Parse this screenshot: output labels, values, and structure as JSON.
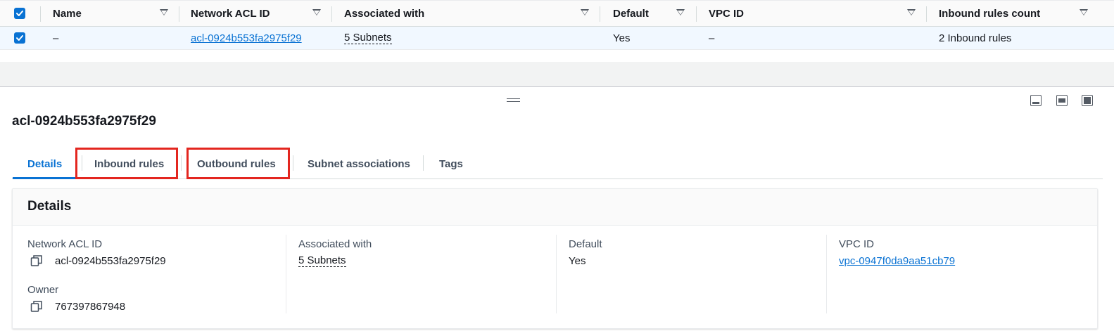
{
  "table": {
    "columns": [
      "Name",
      "Network ACL ID",
      "Associated with",
      "Default",
      "VPC ID",
      "Inbound rules count"
    ],
    "row": {
      "name": "–",
      "network_acl_id": "acl-0924b553fa2975f29",
      "associated_with": "5 Subnets",
      "default": "Yes",
      "vpc_id": "–",
      "inbound_rules_count": "2 Inbound rules",
      "selected": true
    }
  },
  "panel": {
    "title": "acl-0924b553fa2975f29",
    "tabs": [
      "Details",
      "Inbound rules",
      "Outbound rules",
      "Subnet associations",
      "Tags"
    ],
    "active_tab": "Details",
    "highlighted_tabs": [
      "Inbound rules",
      "Outbound rules"
    ],
    "details": {
      "heading": "Details",
      "network_acl_id_label": "Network ACL ID",
      "network_acl_id": "acl-0924b553fa2975f29",
      "owner_label": "Owner",
      "owner": "767397867948",
      "associated_with_label": "Associated with",
      "associated_with": "5 Subnets",
      "default_label": "Default",
      "default": "Yes",
      "vpc_id_label": "VPC ID",
      "vpc_id": "vpc-0947f0da9aa51cb79"
    }
  },
  "colors": {
    "accent": "#0972d3",
    "highlight": "#e3261f",
    "selected_row": "#f1f8ff"
  },
  "icons": [
    "checkbox-checked-icon",
    "sort-caret-icon",
    "drag-handle-icon",
    "panel-bottom-icon",
    "panel-side-icon",
    "panel-full-icon",
    "copy-icon"
  ]
}
